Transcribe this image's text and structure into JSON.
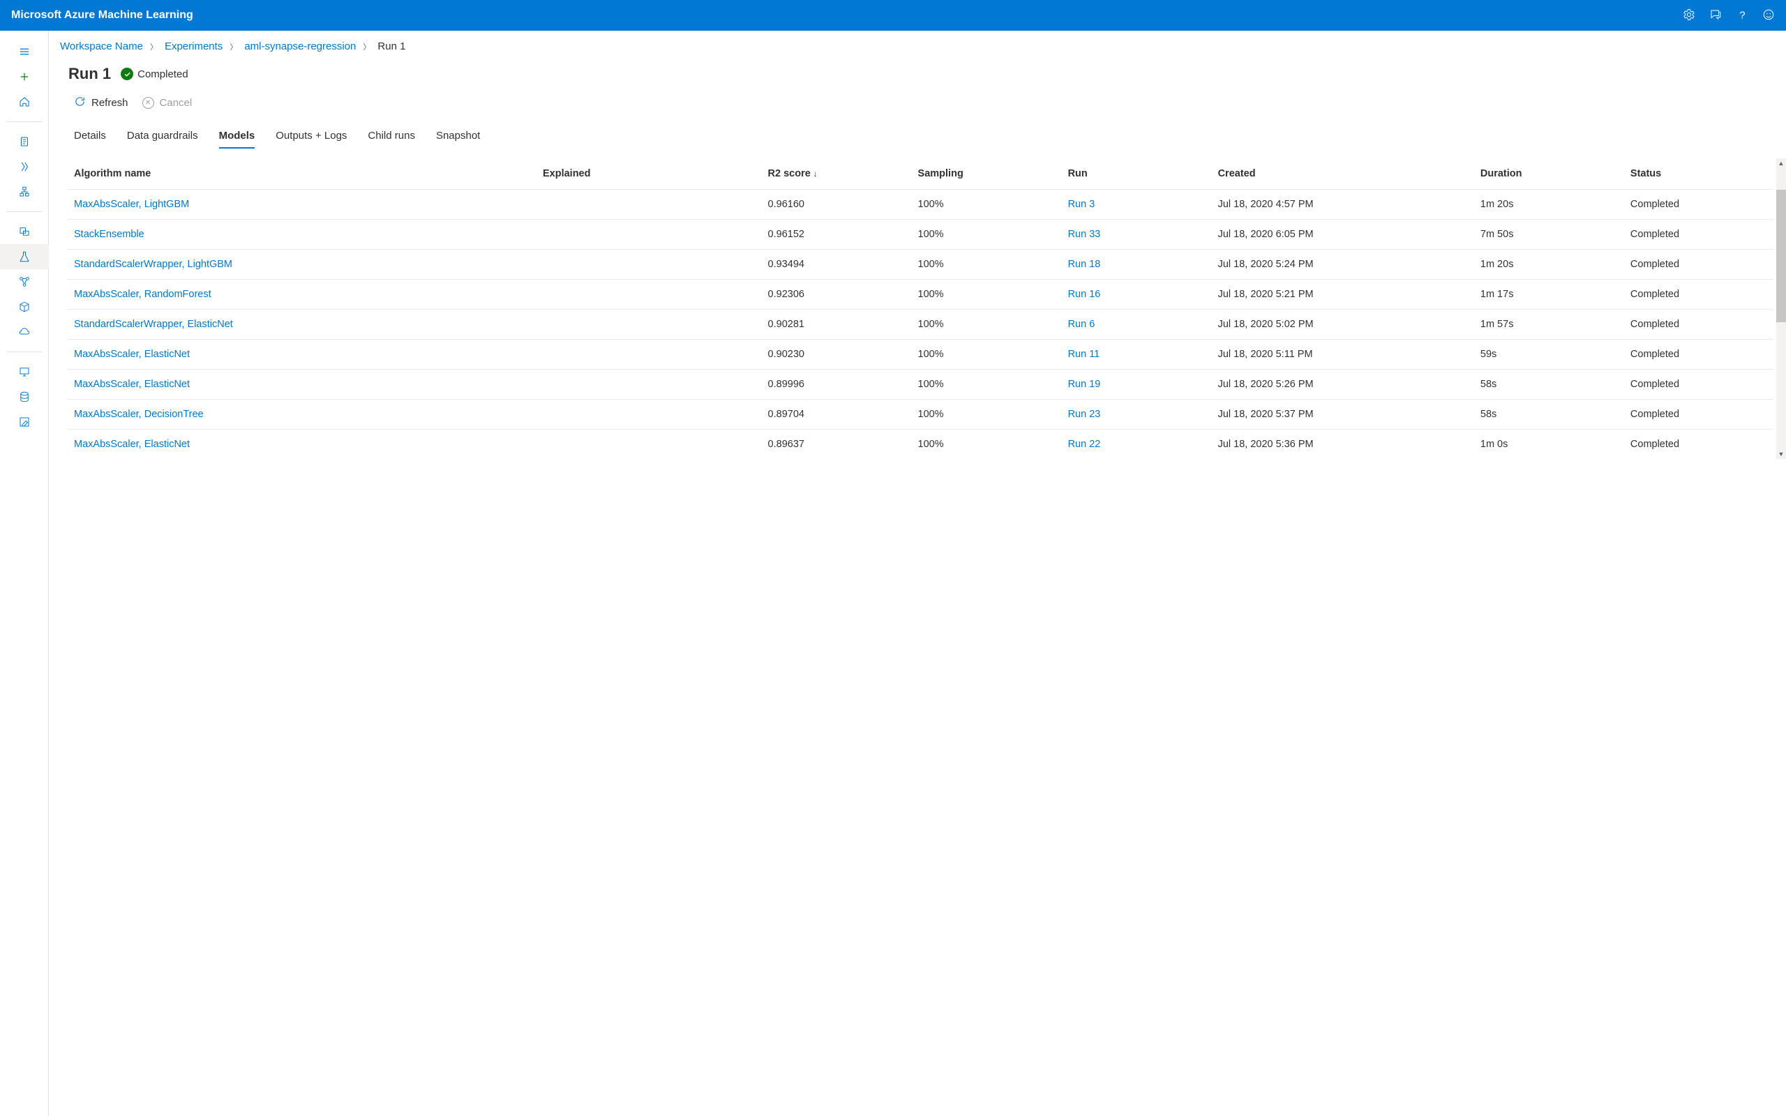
{
  "header": {
    "title": "Microsoft Azure Machine Learning"
  },
  "breadcrumb": {
    "items": [
      "Workspace Name",
      "Experiments",
      "aml-synapse-regression"
    ],
    "current": "Run 1"
  },
  "page": {
    "title": "Run 1",
    "status": "Completed",
    "actions": {
      "refresh": "Refresh",
      "cancel": "Cancel"
    }
  },
  "tabs": [
    "Details",
    "Data guardrails",
    "Models",
    "Outputs + Logs",
    "Child runs",
    "Snapshot"
  ],
  "active_tab": "Models",
  "table": {
    "columns": [
      "Algorithm name",
      "Explained",
      "R2 score",
      "Sampling",
      "Run",
      "Created",
      "Duration",
      "Status"
    ],
    "sort_column": "R2 score",
    "sort_dir": "desc",
    "rows": [
      {
        "algo": "MaxAbsScaler, LightGBM",
        "explained": "",
        "r2": "0.96160",
        "sampling": "100%",
        "run": "Run 3",
        "created": "Jul 18, 2020 4:57 PM",
        "duration": "1m 20s",
        "status": "Completed"
      },
      {
        "algo": "StackEnsemble",
        "explained": "",
        "r2": "0.96152",
        "sampling": "100%",
        "run": "Run 33",
        "created": "Jul 18, 2020 6:05 PM",
        "duration": "7m 50s",
        "status": "Completed"
      },
      {
        "algo": "StandardScalerWrapper, LightGBM",
        "explained": "",
        "r2": "0.93494",
        "sampling": "100%",
        "run": "Run 18",
        "created": "Jul 18, 2020 5:24 PM",
        "duration": "1m 20s",
        "status": "Completed"
      },
      {
        "algo": "MaxAbsScaler, RandomForest",
        "explained": "",
        "r2": "0.92306",
        "sampling": "100%",
        "run": "Run 16",
        "created": "Jul 18, 2020 5:21 PM",
        "duration": "1m 17s",
        "status": "Completed"
      },
      {
        "algo": "StandardScalerWrapper, ElasticNet",
        "explained": "",
        "r2": "0.90281",
        "sampling": "100%",
        "run": "Run 6",
        "created": "Jul 18, 2020 5:02 PM",
        "duration": "1m 57s",
        "status": "Completed"
      },
      {
        "algo": "MaxAbsScaler, ElasticNet",
        "explained": "",
        "r2": "0.90230",
        "sampling": "100%",
        "run": "Run 11",
        "created": "Jul 18, 2020 5:11 PM",
        "duration": "59s",
        "status": "Completed"
      },
      {
        "algo": "MaxAbsScaler, ElasticNet",
        "explained": "",
        "r2": "0.89996",
        "sampling": "100%",
        "run": "Run 19",
        "created": "Jul 18, 2020 5:26 PM",
        "duration": "58s",
        "status": "Completed"
      },
      {
        "algo": "MaxAbsScaler, DecisionTree",
        "explained": "",
        "r2": "0.89704",
        "sampling": "100%",
        "run": "Run 23",
        "created": "Jul 18, 2020 5:37 PM",
        "duration": "58s",
        "status": "Completed"
      },
      {
        "algo": "MaxAbsScaler, ElasticNet",
        "explained": "",
        "r2": "0.89637",
        "sampling": "100%",
        "run": "Run 22",
        "created": "Jul 18, 2020 5:36 PM",
        "duration": "1m 0s",
        "status": "Completed"
      }
    ]
  }
}
